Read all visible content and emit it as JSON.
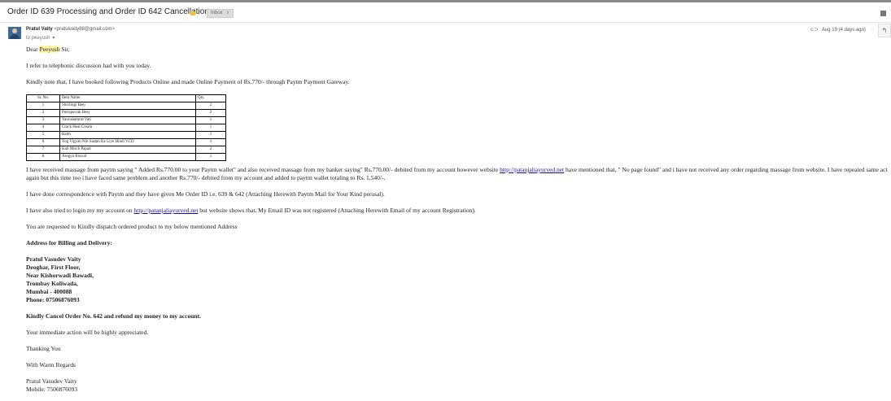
{
  "subject": {
    "title": "Order ID 639 Processing and Order ID 642 Cancellation",
    "label": "Inbox",
    "label_close": "x"
  },
  "sender": {
    "name": "Pratul Vaity",
    "email": "<pratulvaity88@gmail.com>",
    "to": "to peeyush"
  },
  "meta": {
    "date": "Aug 19 (4 days ago)"
  },
  "colors": {
    "accent": "#1a0dab",
    "important": "#f3c03c",
    "highlight": "#fff7a8"
  },
  "body": {
    "greeting_prefix": "Dear ",
    "greeting_name": "Peeyush",
    "greeting_suffix": " Sir,",
    "p1": "I refer to telephonic discussion had with you today.",
    "p2": "Kindly note that, I have booked following Products Online and made Online Payment of Rs.770/- through Paytm Payment Gateway.",
    "table": {
      "headers": [
        "Sr. No.",
        "Item Name",
        "Qty."
      ],
      "rows": [
        [
          "1",
          "Shivlingi Beej",
          "2"
        ],
        [
          "2",
          "Putrajeevak Beej",
          "2"
        ],
        [
          "3",
          "Yauvanamrut Vati",
          "1"
        ],
        [
          "4",
          "Crack Heal Cream",
          "1"
        ],
        [
          "5",
          "Balm",
          "1"
        ],
        [
          "6",
          "Yog Vigyan Nih Sastan Ke Liye Hindi VCD",
          "1"
        ],
        [
          "7",
          "Kali Mirch Papad",
          "2"
        ],
        [
          "8",
          "Arogya Biscuit",
          "1"
        ]
      ]
    },
    "p3_a": "I have received massage from paytm saying \" Added Rs.770.00 to your Paytm wallet\" and also received massage from my banker saying\" Rs.770.00/- debited from my account however website ",
    "p3_link": "http://patanjaliayurved.net",
    "p3_b": " have mentioned that, \" No page found\" and i have not received any order regarding massage from website. I have repeated same act again but this time too i have faced same problem and another Rs.770/- debited from my account and added to paytm wallet totaling to Rs. 1,540/-.",
    "p4": "I have done correspondence with Paytm and they have given Me Order ID i.e. 639 & 642 (Attaching Herewith Paytm Mail for Your Kind perusal).",
    "p5_a": "I have also tried to login my my account on ",
    "p5_link": "http://patanjaliayurved.net",
    "p5_b": " but website shows that, My Email ID was not registered (Attaching Herewith Email of my account Registration).",
    "p6": "You are requested to Kindly dispatch ordered product  to my below mentioned Address",
    "addr_title": "Address for Billing and Delivery:",
    "address": [
      "Pratul Vasudev Vaity",
      "Deoghar, First Floor,",
      "Near Kishorwadi Bawadi,",
      "Trombay Koliwada,",
      "Mumbai - 400088",
      "Phone: 07506876093"
    ],
    "cancel": "Kindly Cancel Order No. 642 and refund my money to my account.",
    "p7": "Your immediate action will be highly appreciated.",
    "p8": "Thanking You",
    "p9": "With Warm Regards",
    "sig_name": "Pratul Vasudev Vaity",
    "sig_mobile": "Mobile: 7506876093"
  }
}
